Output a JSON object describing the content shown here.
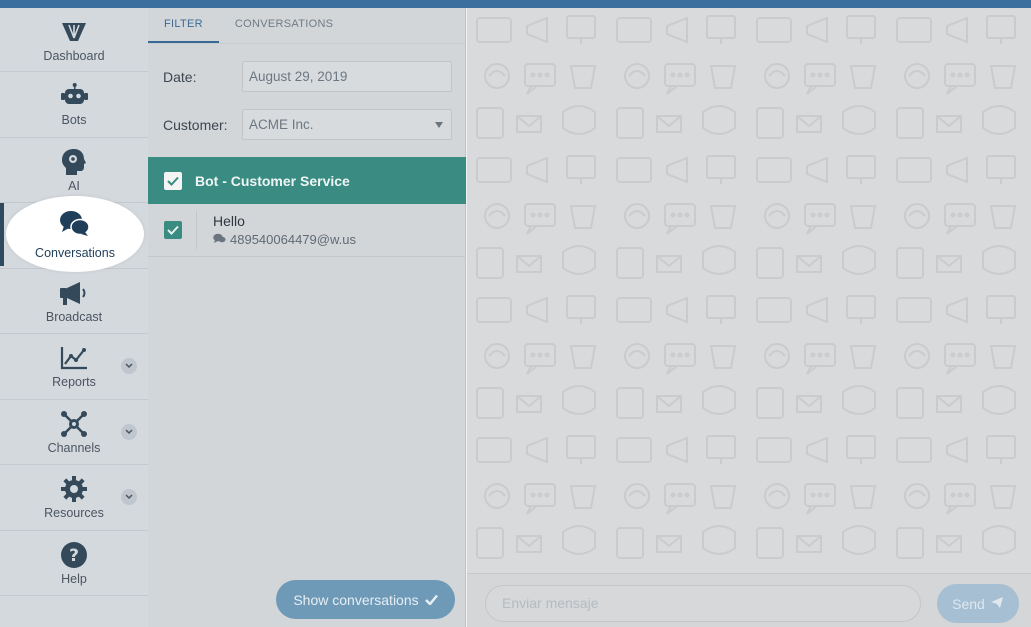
{
  "sidebar": {
    "items": [
      {
        "label": "Dashboard",
        "icon": "dashboard-icon"
      },
      {
        "label": "Bots",
        "icon": "robot-icon"
      },
      {
        "label": "AI",
        "icon": "brain-icon"
      },
      {
        "label": "Conversations",
        "icon": "chat-bubbles-icon"
      },
      {
        "label": "Broadcast",
        "icon": "megaphone-icon"
      },
      {
        "label": "Reports",
        "icon": "chart-icon"
      },
      {
        "label": "Channels",
        "icon": "network-icon"
      },
      {
        "label": "Resources",
        "icon": "gear-icon"
      },
      {
        "label": "Help",
        "icon": "help-icon"
      }
    ]
  },
  "tabs": {
    "filter": "FILTER",
    "conversations": "CONVERSATIONS"
  },
  "filter": {
    "date_label": "Date:",
    "date_value": "August 29, 2019",
    "customer_label": "Customer:",
    "customer_value": "ACME Inc."
  },
  "group": {
    "title": "Bot - Customer Service"
  },
  "conversation": {
    "title": "Hello",
    "contact": "489540064479@w.us"
  },
  "actions": {
    "show_conversations": "Show conversations",
    "send": "Send"
  },
  "composer": {
    "placeholder": "Enviar mensaje"
  },
  "colors": {
    "accent": "#3a8c83",
    "brand": "#3b6f9e"
  }
}
